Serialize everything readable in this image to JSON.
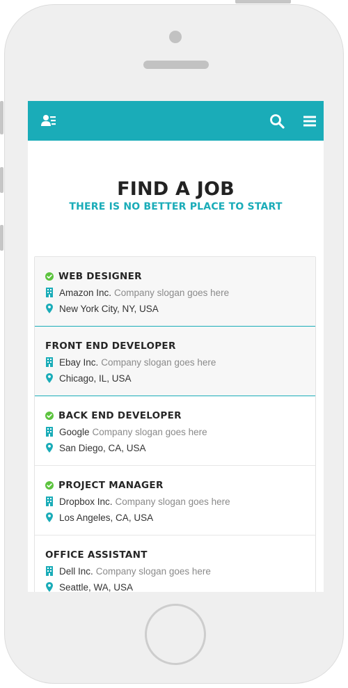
{
  "colors": {
    "accent": "#1aacb8",
    "check": "#5cc33e",
    "frame": "#efefef"
  },
  "navbar": {
    "left_icon": "user-list-icon",
    "right_icons": [
      "search-icon",
      "menu-icon"
    ]
  },
  "hero": {
    "title": "FIND A JOB",
    "subtitle": "THERE IS NO BETTER PLACE TO START"
  },
  "jobs": [
    {
      "title": "WEB DESIGNER",
      "verified": true,
      "company": "Amazon Inc.",
      "slogan": "Company slogan goes here",
      "location": "New York City, NY, USA",
      "highlighted": true
    },
    {
      "title": "FRONT END DEVELOPER",
      "verified": false,
      "company": "Ebay Inc.",
      "slogan": "Company slogan goes here",
      "location": "Chicago, IL, USA",
      "highlighted": true
    },
    {
      "title": "BACK END DEVELOPER",
      "verified": true,
      "company": "Google",
      "slogan": "Company slogan goes here",
      "location": "San Diego, CA, USA",
      "highlighted": false
    },
    {
      "title": "PROJECT MANAGER",
      "verified": true,
      "company": "Dropbox Inc.",
      "slogan": "Company slogan goes here",
      "location": "Los Angeles, CA, USA",
      "highlighted": false
    },
    {
      "title": "OFFICE ASSISTANT",
      "verified": false,
      "company": "Dell Inc.",
      "slogan": "Company slogan goes here",
      "location": "Seattle, WA, USA",
      "highlighted": false
    }
  ]
}
